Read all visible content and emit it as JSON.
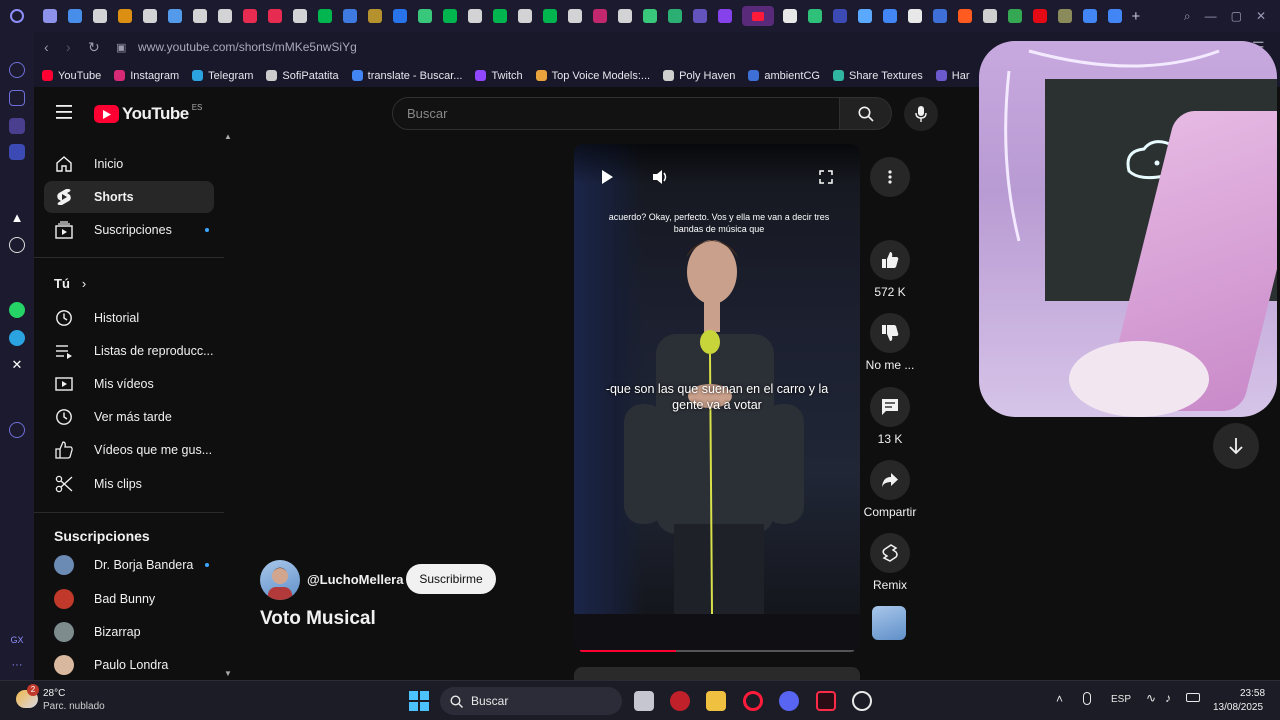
{
  "browser": {
    "url": "www.youtube.com/shorts/mMKe5nwSiYg",
    "bookmarks": [
      {
        "label": "YouTube",
        "color": "#ff0033"
      },
      {
        "label": "Instagram",
        "color": "#d62976"
      },
      {
        "label": "Telegram",
        "color": "#2aa3e0"
      },
      {
        "label": "SofiPatatita",
        "color": "#cccccc"
      },
      {
        "label": "translate - Buscar...",
        "color": "#4285f4"
      },
      {
        "label": "Twitch",
        "color": "#9146ff"
      },
      {
        "label": "Top Voice Models:...",
        "color": "#e8a33d"
      },
      {
        "label": "Poly Haven",
        "color": "#cfcfcf"
      },
      {
        "label": "ambientCG",
        "color": "#3d6fd6"
      },
      {
        "label": "Share Textures",
        "color": "#2fb5a0"
      },
      {
        "label": "Har",
        "color": "#6a5acd"
      }
    ]
  },
  "youtube": {
    "logo_text": "YouTube",
    "country_code": "ES",
    "search_placeholder": "Buscar",
    "nav_main": [
      {
        "label": "Inicio",
        "icon": "home-icon"
      },
      {
        "label": "Shorts",
        "icon": "shorts-icon"
      },
      {
        "label": "Suscripciones",
        "icon": "subscriptions-icon"
      }
    ],
    "you_title": "Tú",
    "nav_you": [
      {
        "label": "Historial",
        "icon": "history-icon"
      },
      {
        "label": "Listas de reproducc...",
        "icon": "playlists-icon"
      },
      {
        "label": "Mis vídeos",
        "icon": "your-videos-icon"
      },
      {
        "label": "Ver más tarde",
        "icon": "watch-later-icon"
      },
      {
        "label": "Vídeos que me gus...",
        "icon": "liked-videos-icon"
      },
      {
        "label": "Mis clips",
        "icon": "clips-icon"
      }
    ],
    "subscriptions_title": "Suscripciones",
    "subscriptions": [
      {
        "label": "Dr. Borja Bandera",
        "color": "#6b8bb5"
      },
      {
        "label": "Bad Bunny",
        "color": "#c0392b"
      },
      {
        "label": "Bizarrap",
        "color": "#7f8c8d"
      },
      {
        "label": "Paulo Londra",
        "color": "#d8b9a0"
      }
    ]
  },
  "short": {
    "caption_top": "acuerdo? Okay, perfecto. Vos y ella me van a decir tres bandas de música que",
    "caption_mid": "-que son las que suenan en el carro y la gente va a votar",
    "progress": 0.35,
    "channel": "@LuchoMellera",
    "subscribe_label": "Suscribirme",
    "title": "Voto Musical",
    "actions": [
      {
        "icon": "like-icon",
        "label": "572 K"
      },
      {
        "icon": "dislike-icon",
        "label": "No me ..."
      },
      {
        "icon": "comment-icon",
        "label": "13 K"
      },
      {
        "icon": "share-icon",
        "label": "Compartir"
      },
      {
        "icon": "remix-icon",
        "label": "Remix"
      }
    ]
  },
  "taskbar": {
    "weather_temp": "28°C",
    "weather_desc": "Parc. nublado",
    "weather_badge": "2",
    "search_label": "Buscar",
    "language": "ESP",
    "time": "23:58",
    "date": "13/08/2025"
  }
}
